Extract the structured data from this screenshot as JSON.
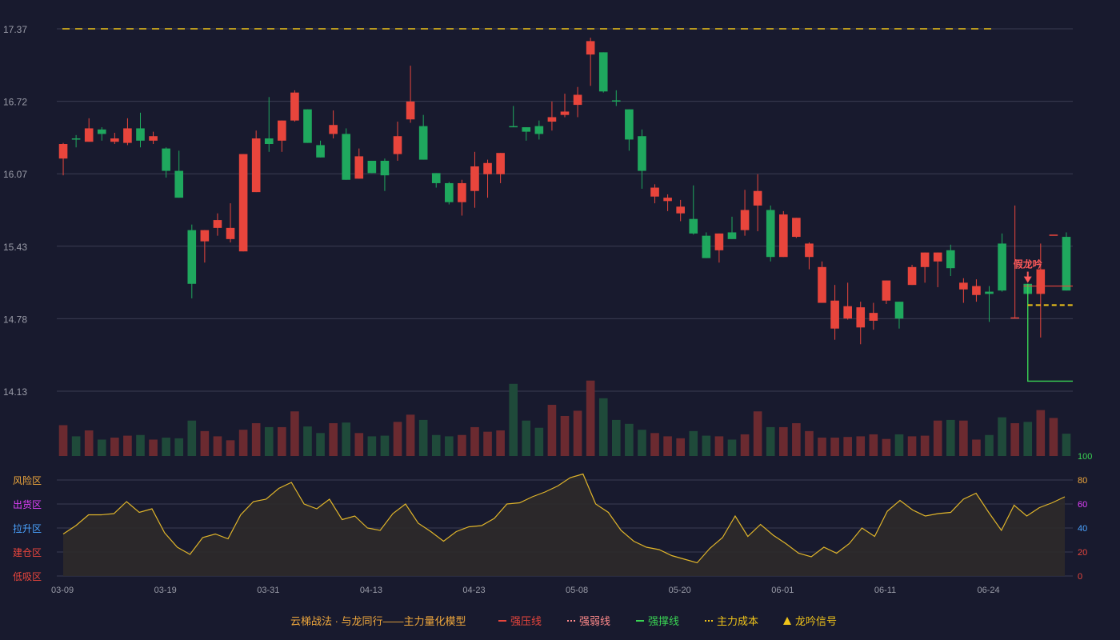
{
  "colors": {
    "background": "#181a2e",
    "grid": "#3a3c52",
    "up": "#e8453c",
    "down": "#1fa85e",
    "vol_up": "#6b2a30",
    "vol_down": "#1f4a3a",
    "cost": "#f0c419",
    "support": "#39d353",
    "osc_line": "#e0b52a",
    "osc_fill": "#2e2a2a",
    "axis_text": "#9a9ca8",
    "signal": "#ff5a5a"
  },
  "price_axis": {
    "min": 14.13,
    "max": 17.37,
    "ticks": [
      "17.37",
      "16.72",
      "16.07",
      "15.43",
      "14.78",
      "14.13"
    ]
  },
  "cost_line_top": 17.37,
  "osc_axis": {
    "ticks": [
      "100",
      "80",
      "60",
      "40",
      "20",
      "0"
    ],
    "tick_colors": [
      "#39d353",
      "#f0a83c",
      "#e040fb",
      "#4aa3ff",
      "#e8453c",
      "#e8453c"
    ],
    "zones": [
      {
        "label": "风险区",
        "color": "#f0a83c"
      },
      {
        "label": "出货区",
        "color": "#e040fb"
      },
      {
        "label": "拉升区",
        "color": "#4aa3ff"
      },
      {
        "label": "建仓区",
        "color": "#e8453c"
      },
      {
        "label": "低吸区",
        "color": "#e8453c"
      }
    ]
  },
  "x_labels": [
    {
      "i": 0,
      "label": "03-09"
    },
    {
      "i": 8,
      "label": "03-19"
    },
    {
      "i": 16,
      "label": "03-31"
    },
    {
      "i": 24,
      "label": "04-13"
    },
    {
      "i": 32,
      "label": "04-23"
    },
    {
      "i": 40,
      "label": "05-08"
    },
    {
      "i": 48,
      "label": "05-20"
    },
    {
      "i": 56,
      "label": "06-01"
    },
    {
      "i": 64,
      "label": "06-11"
    },
    {
      "i": 72,
      "label": "06-24"
    }
  ],
  "signal": {
    "index": 75,
    "label": "假龙吟"
  },
  "chart_data": {
    "type": "candlestick",
    "candles": [
      [
        16.21,
        16.34,
        16.06,
        16.35,
        0.47
      ],
      [
        16.39,
        16.38,
        16.31,
        16.42,
        0.3
      ],
      [
        16.36,
        16.48,
        16.36,
        16.57,
        0.39
      ],
      [
        16.47,
        16.43,
        16.37,
        16.49,
        0.25
      ],
      [
        16.36,
        16.39,
        16.34,
        16.44,
        0.28
      ],
      [
        16.35,
        16.48,
        16.33,
        16.57,
        0.31
      ],
      [
        16.48,
        16.37,
        16.31,
        16.62,
        0.32
      ],
      [
        16.37,
        16.41,
        16.34,
        16.45,
        0.25
      ],
      [
        16.3,
        16.1,
        16.04,
        16.31,
        0.28
      ],
      [
        16.1,
        15.86,
        15.86,
        16.28,
        0.27
      ],
      [
        15.57,
        15.09,
        14.96,
        15.62,
        0.54
      ],
      [
        15.47,
        15.57,
        15.28,
        15.57,
        0.38
      ],
      [
        15.59,
        15.66,
        15.52,
        15.72,
        0.3
      ],
      [
        15.49,
        15.59,
        15.46,
        15.81,
        0.24
      ],
      [
        15.38,
        16.25,
        15.38,
        16.25,
        0.4
      ],
      [
        15.91,
        16.39,
        15.92,
        16.46,
        0.5
      ],
      [
        16.39,
        16.34,
        16.27,
        16.76,
        0.44
      ],
      [
        16.37,
        16.55,
        16.27,
        16.55,
        0.44
      ],
      [
        16.55,
        16.8,
        16.54,
        16.82,
        0.68
      ],
      [
        16.65,
        16.35,
        16.38,
        16.65,
        0.45
      ],
      [
        16.33,
        16.22,
        16.22,
        16.37,
        0.35
      ],
      [
        16.43,
        16.51,
        16.39,
        16.64,
        0.5
      ],
      [
        16.43,
        16.02,
        16.02,
        16.48,
        0.51
      ],
      [
        16.03,
        16.23,
        16.03,
        16.3,
        0.35
      ],
      [
        16.19,
        16.08,
        16.16,
        16.19,
        0.3
      ],
      [
        16.19,
        16.06,
        15.92,
        16.21,
        0.31
      ],
      [
        16.25,
        16.41,
        16.19,
        16.54,
        0.52
      ],
      [
        16.56,
        16.72,
        16.53,
        17.04,
        0.63
      ],
      [
        16.5,
        16.2,
        16.2,
        16.6,
        0.55
      ],
      [
        16.08,
        15.99,
        15.95,
        16.07,
        0.32
      ],
      [
        15.99,
        15.82,
        15.8,
        16.0,
        0.3
      ],
      [
        15.82,
        15.99,
        15.7,
        16.02,
        0.32
      ],
      [
        15.92,
        16.14,
        15.77,
        16.27,
        0.44
      ],
      [
        16.07,
        16.17,
        15.86,
        16.2,
        0.37
      ],
      [
        16.07,
        16.26,
        15.99,
        16.25,
        0.39
      ],
      [
        16.5,
        16.49,
        16.49,
        16.68,
        1.1
      ],
      [
        16.49,
        16.45,
        16.37,
        16.48,
        0.54
      ],
      [
        16.5,
        16.43,
        16.38,
        16.55,
        0.43
      ],
      [
        16.54,
        16.58,
        16.46,
        16.72,
        0.78
      ],
      [
        16.6,
        16.63,
        16.58,
        16.79,
        0.61
      ],
      [
        16.69,
        16.78,
        16.58,
        16.85,
        0.69
      ],
      [
        17.14,
        17.26,
        16.86,
        17.29,
        1.15
      ],
      [
        17.16,
        16.81,
        16.8,
        17.13,
        0.88
      ],
      [
        16.73,
        16.72,
        16.68,
        16.82,
        0.55
      ],
      [
        16.65,
        16.38,
        16.28,
        16.65,
        0.49
      ],
      [
        16.41,
        16.1,
        15.94,
        16.47,
        0.4
      ],
      [
        15.87,
        15.95,
        15.81,
        15.98,
        0.35
      ],
      [
        15.83,
        15.86,
        15.74,
        15.89,
        0.3
      ],
      [
        15.72,
        15.78,
        15.65,
        15.84,
        0.27
      ],
      [
        15.67,
        15.54,
        15.53,
        15.97,
        0.38
      ],
      [
        15.52,
        15.32,
        15.32,
        15.55,
        0.31
      ],
      [
        15.39,
        15.54,
        15.28,
        15.54,
        0.3
      ],
      [
        15.55,
        15.49,
        15.49,
        15.69,
        0.25
      ],
      [
        15.57,
        15.75,
        15.52,
        15.93,
        0.33
      ],
      [
        15.79,
        15.92,
        15.56,
        16.07,
        0.68
      ],
      [
        15.75,
        15.33,
        15.29,
        15.79,
        0.44
      ],
      [
        15.33,
        15.71,
        15.34,
        15.74,
        0.44
      ],
      [
        15.51,
        15.68,
        15.5,
        15.68,
        0.5
      ],
      [
        15.33,
        15.45,
        15.22,
        15.46,
        0.38
      ],
      [
        14.92,
        15.24,
        14.92,
        15.29,
        0.28
      ],
      [
        14.69,
        14.94,
        14.59,
        15.08,
        0.28
      ],
      [
        14.78,
        14.89,
        14.77,
        15.1,
        0.29
      ],
      [
        14.7,
        14.88,
        14.55,
        14.93,
        0.3
      ],
      [
        14.76,
        14.83,
        14.68,
        14.92,
        0.33
      ],
      [
        14.94,
        15.12,
        14.91,
        15.12,
        0.26
      ],
      [
        14.93,
        14.78,
        14.69,
        14.93,
        0.33
      ],
      [
        15.08,
        15.24,
        15.08,
        15.26,
        0.3
      ],
      [
        15.24,
        15.37,
        15.1,
        15.37,
        0.31
      ],
      [
        15.29,
        15.37,
        15.06,
        15.37,
        0.54
      ],
      [
        15.39,
        15.23,
        15.16,
        15.44,
        0.55
      ],
      [
        15.04,
        15.1,
        14.92,
        15.14,
        0.54
      ],
      [
        14.99,
        15.07,
        14.93,
        15.13,
        0.25
      ],
      [
        15.02,
        15.0,
        14.75,
        15.07,
        0.32
      ],
      [
        15.45,
        15.03,
        15.02,
        15.54,
        0.59
      ],
      [
        14.78,
        14.79,
        15.23,
        15.79,
        0.5
      ],
      [
        15.09,
        15.0,
        15.22,
        15.07,
        0.52
      ],
      [
        15.0,
        15.22,
        14.61,
        15.45,
        0.7
      ],
      [
        15.53,
        15.53,
        15.62,
        15.46,
        0.58
      ],
      [
        15.51,
        15.03,
        15.47,
        15.55,
        0.34
      ]
    ],
    "osc": [
      35,
      42,
      51,
      51,
      52,
      62,
      53,
      56,
      36,
      24,
      18,
      32,
      35,
      31,
      51,
      62,
      64,
      73,
      78,
      60,
      56,
      64,
      47,
      50,
      40,
      38,
      52,
      60,
      44,
      37,
      29,
      37,
      41,
      42,
      48,
      60,
      61,
      66,
      70,
      75,
      82,
      85,
      60,
      53,
      38,
      29,
      24,
      22,
      17,
      14,
      11,
      23,
      32,
      50,
      33,
      43,
      34,
      27,
      19,
      16,
      24,
      19,
      27,
      40,
      33,
      54,
      63,
      55,
      50,
      52,
      53,
      64,
      69,
      53,
      38,
      59,
      50,
      57,
      61,
      66
    ]
  },
  "legend": [
    {
      "text": "云梯战法 · 与龙同行——主力量化模型",
      "color": "#f0a83c",
      "marker": ""
    },
    {
      "text": "强压线",
      "color": "#e8453c",
      "marker": "line-solid"
    },
    {
      "text": "强弱线",
      "color": "#ff8a8a",
      "marker": "line-dotted"
    },
    {
      "text": "强撑线",
      "color": "#39d353",
      "marker": "line-solid"
    },
    {
      "text": "主力成本",
      "color": "#f0c419",
      "marker": "line-dotted"
    },
    {
      "text": "龙吟信号",
      "color": "#f0c419",
      "marker": "triangle"
    }
  ]
}
